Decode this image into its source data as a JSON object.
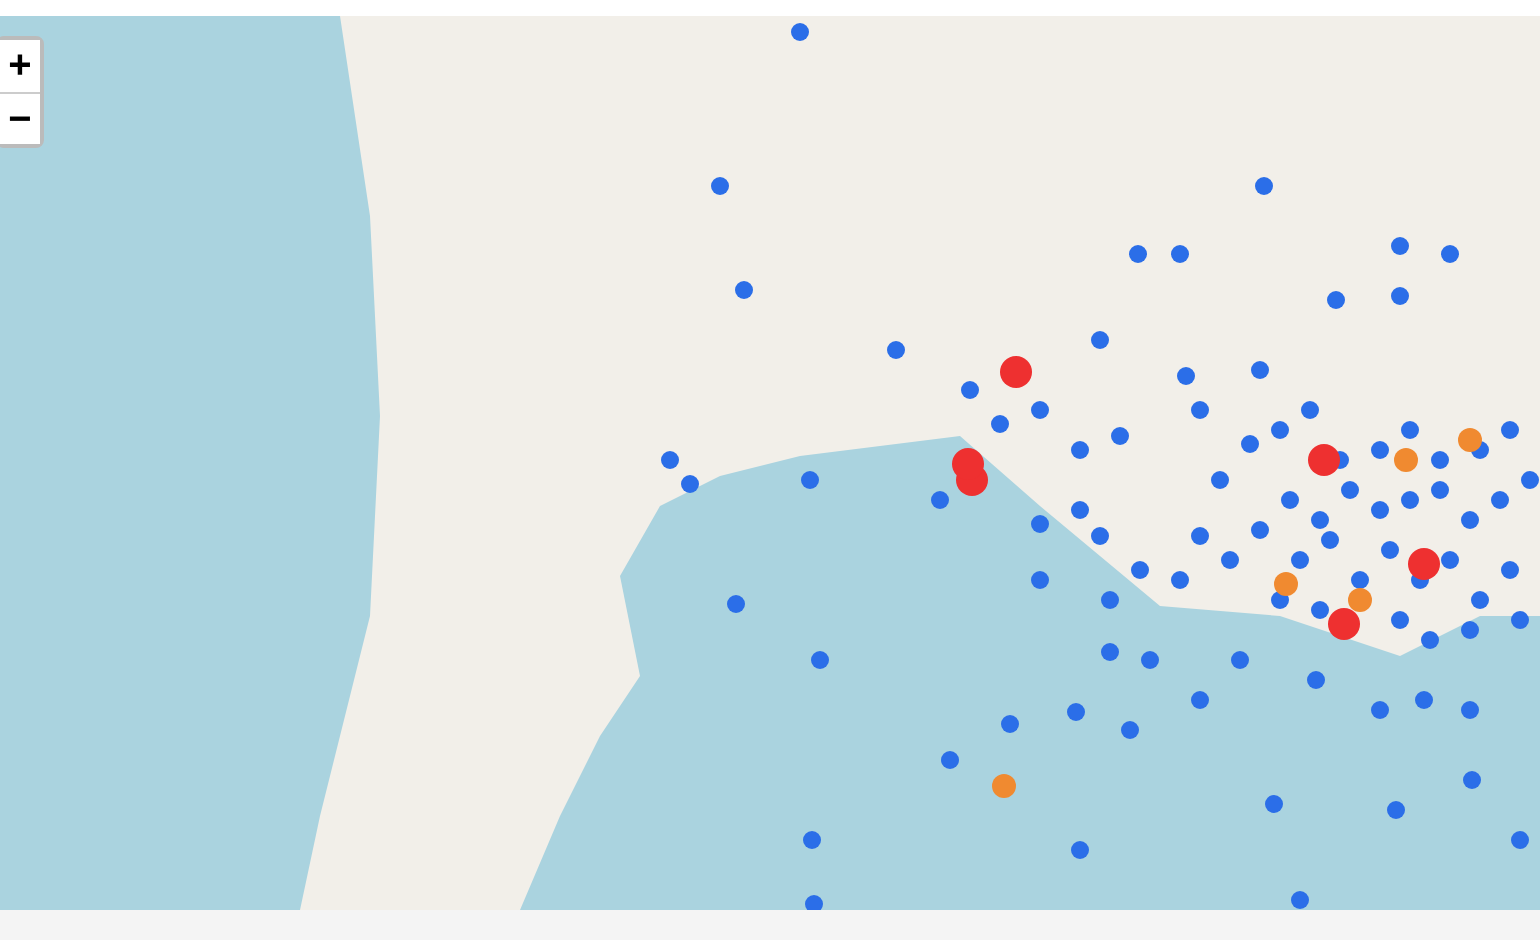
{
  "zoom_controls": [
    {
      "label": "+"
    },
    {
      "label": "−"
    }
  ]
}
